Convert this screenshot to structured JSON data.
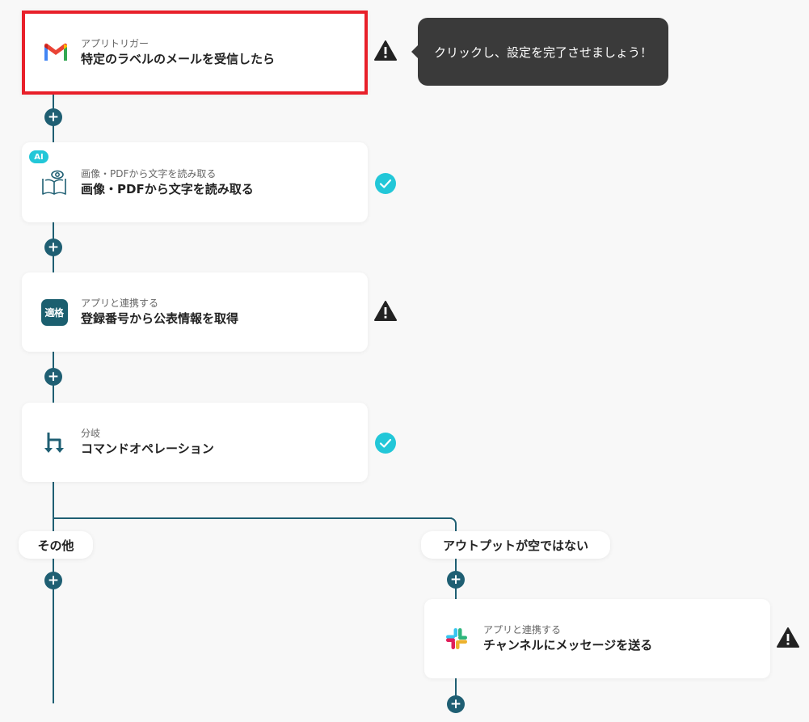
{
  "tooltip": {
    "text": "クリックし、設定を完了させましょう！"
  },
  "steps": [
    {
      "subtitle": "アプリトリガー",
      "title": "特定のラベルのメールを受信したら",
      "icon": "gmail-icon",
      "status": "warning"
    },
    {
      "badge": "AI",
      "subtitle": "画像・PDFから文字を読み取る",
      "title": "画像・PDFから文字を読み取る",
      "icon": "book-eye-icon",
      "status": "complete"
    },
    {
      "subtitle": "アプリと連携する",
      "title": "登録番号から公表情報を取得",
      "icon": "tekikaku-app-icon",
      "icon_text": "適格",
      "status": "warning"
    },
    {
      "subtitle": "分岐",
      "title": "コマンドオペレーション",
      "icon": "branch-icon",
      "status": "complete"
    }
  ],
  "branches": [
    {
      "label": "その他"
    },
    {
      "label": "アウトプットが空ではない",
      "step": {
        "subtitle": "アプリと連携する",
        "title": "チャンネルにメッセージを送る",
        "icon": "slack-icon",
        "status": "warning"
      }
    }
  ],
  "add_step_symbol": "+",
  "colors": {
    "connector": "#1f5f73",
    "selected_border": "#e8202a",
    "complete": "#22c7d8",
    "warning": "#222222",
    "tooltip_bg": "#3a3a3a"
  }
}
